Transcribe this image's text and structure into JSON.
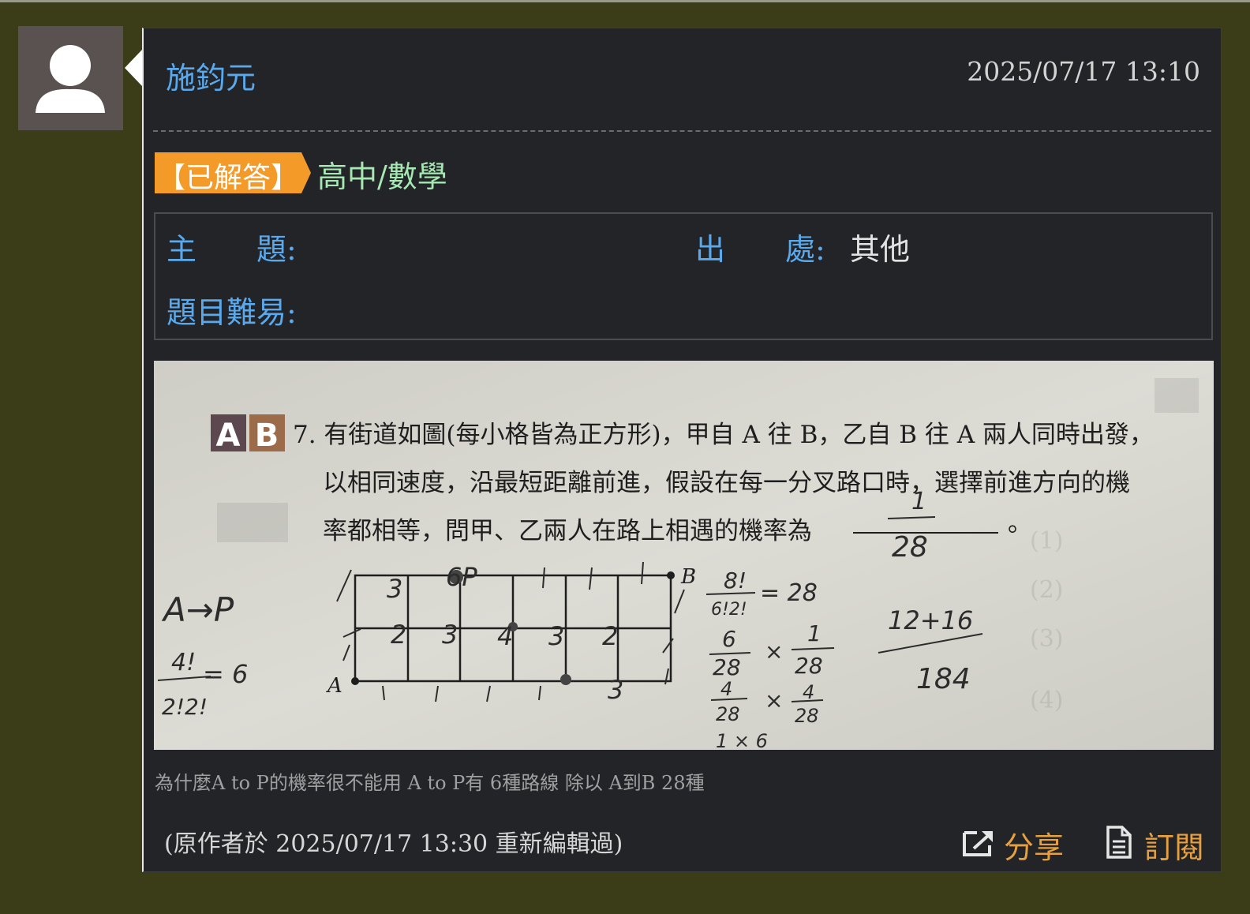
{
  "post": {
    "author": "施鈞元",
    "datetime": "2025/07/17 13:10",
    "status_badge": "【已解答】",
    "category": "高中/數學",
    "fields": {
      "subject_label": "主　　題:",
      "subject_value": "",
      "source_label": "出　　處:",
      "source_value": "其他",
      "difficulty_label": "題目難易:",
      "difficulty_value": ""
    },
    "image": {
      "badge_a": "A",
      "badge_b": "B",
      "question_line1": "7. 有街道如圖(每小格皆為正方形)，甲自 A 往 B，乙自 B 往 A 兩人同時出發，",
      "question_line2": "以相同速度，沿最短距離前進，假設在每一分叉路口時，選擇前進方向的機",
      "question_line3": "率都相等，問甲、乙兩人在路上相遇的機率為",
      "question_end": "。",
      "handwritten_answer_num": "1",
      "handwritten_answer_den": "28",
      "grid_label_a": "A",
      "grid_label_b": "B",
      "grid_label_p": "6P",
      "note_ap": "A→P",
      "note_fact_num": "4!",
      "note_fact_den": "2!2!",
      "note_fact_eq": "= 6",
      "work_line1_num": "8!",
      "work_line1_den": "6!2!",
      "work_line1_eq": "= 28",
      "work_line2_num": "6",
      "work_line2_den": "28",
      "work_line2_times": "×",
      "work_line2_num2": "1",
      "work_line2_den2": "28",
      "work_line3_num": "4",
      "work_line3_den": "28",
      "work_line3_times": "×",
      "work_line3_num2": "4",
      "work_line3_den2": "28",
      "work_line4": "1 × 6",
      "work_sum_num": "12+16",
      "work_sum_den": "184",
      "cell_marks": [
        "3",
        "2",
        "3",
        "4",
        "3",
        "2",
        "3"
      ]
    },
    "caption": "為什麼A to P的機率很不能用 A to P有 6種路線 除以 A到B 28種",
    "edited_note": "(原作者於 2025/07/17 13:30 重新編輯過)",
    "share_label": "分享",
    "subscribe_label": "訂閱"
  },
  "colors": {
    "page_bg": "#3b3c18",
    "card_bg": "#222428",
    "author_blue": "#5aa9ec",
    "badge_orange": "#f39a28",
    "category_green": "#a5e8b1",
    "action_orange": "#e8a03f"
  },
  "icons": {
    "avatar": "user-silhouette-icon",
    "share": "share-icon",
    "subscribe": "document-icon"
  }
}
